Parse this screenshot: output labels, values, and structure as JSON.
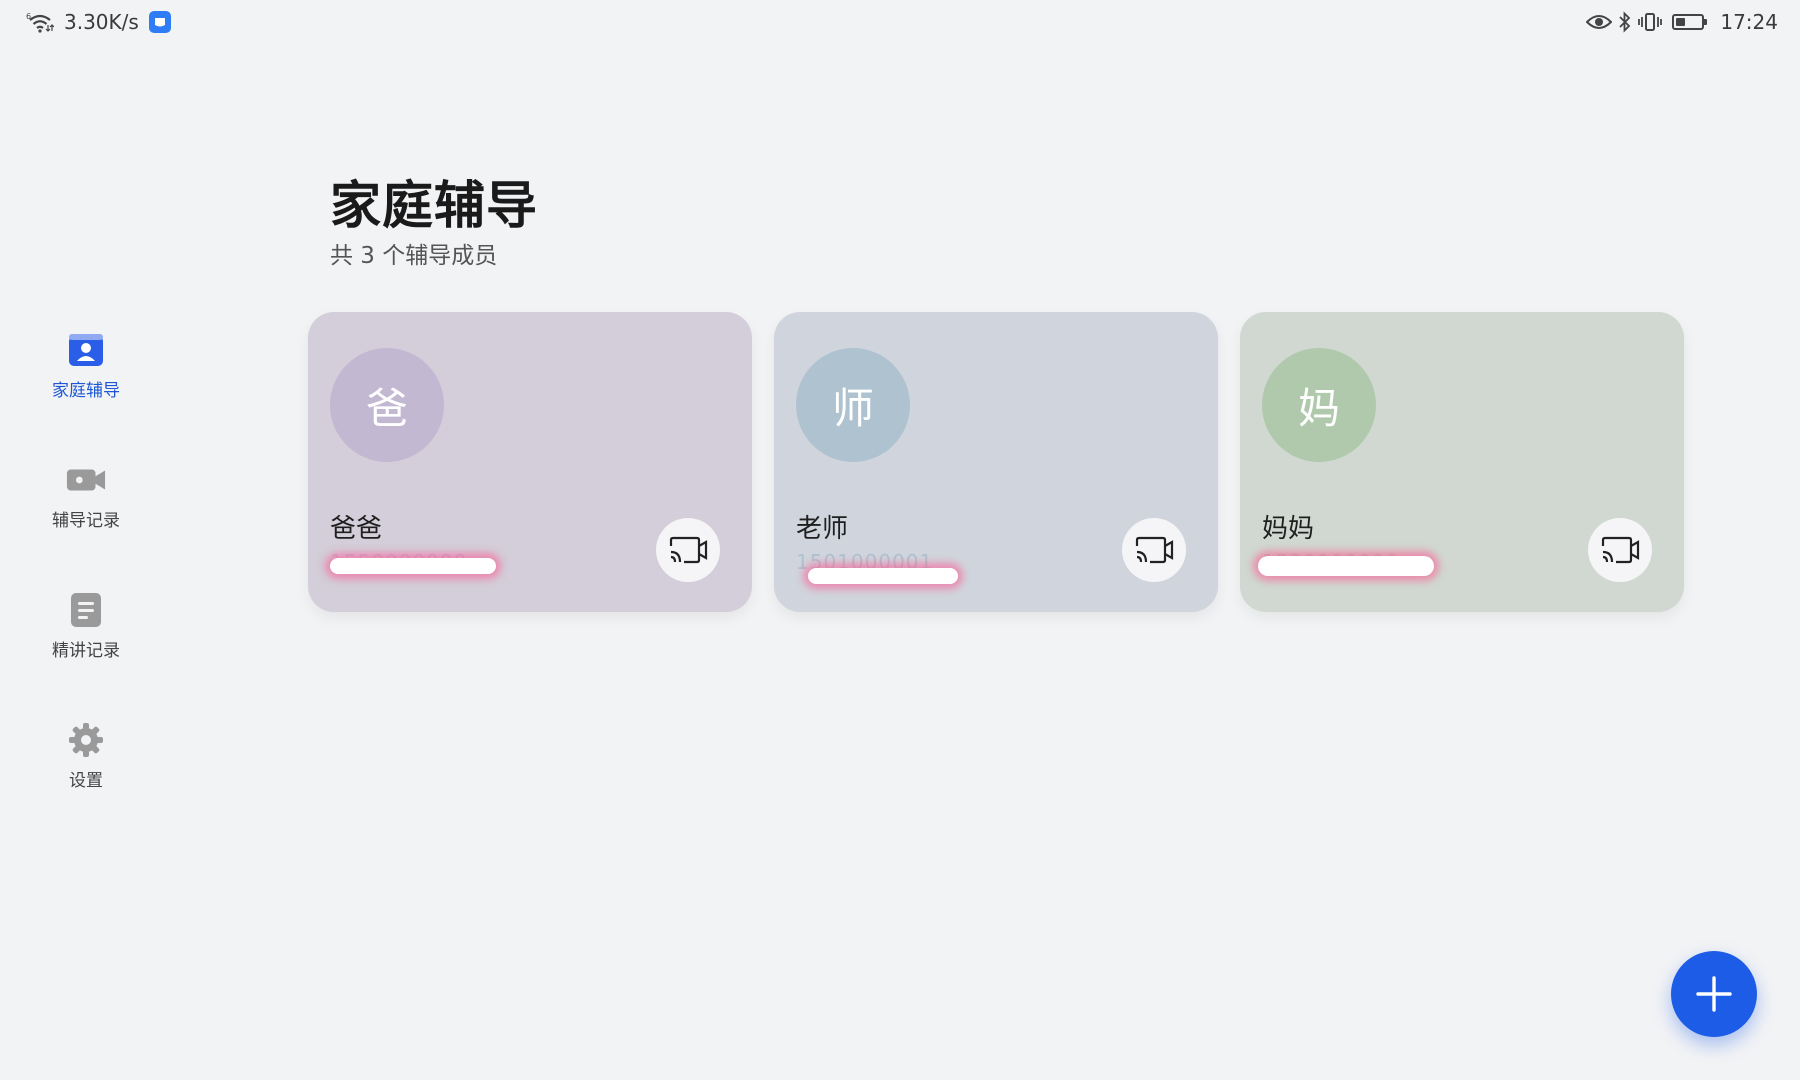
{
  "status_bar": {
    "network_speed": "3.30K/s",
    "time": "17:24",
    "icons": [
      "wifi-icon",
      "app-badge-icon",
      "eye-comfort-icon",
      "bluetooth-icon",
      "vibrate-icon",
      "battery-icon"
    ],
    "battery_level": 0.35
  },
  "sidebar": {
    "items": [
      {
        "label": "家庭辅导",
        "icon": "person-badge-icon",
        "active": true
      },
      {
        "label": "辅导记录",
        "icon": "video-camera-icon",
        "active": false
      },
      {
        "label": "精讲记录",
        "icon": "document-icon",
        "active": false
      },
      {
        "label": "设置",
        "icon": "gear-icon",
        "active": false
      }
    ]
  },
  "header": {
    "title": "家庭辅导",
    "subtitle": "共 3 个辅导成员"
  },
  "members": [
    {
      "avatar_char": "爸",
      "name": "爸爸",
      "phone": "1550000000",
      "card_color": "#d3ced9",
      "avatar_color": "#c3b8d1"
    },
    {
      "avatar_char": "师",
      "name": "老师",
      "phone": "1501000001",
      "card_color": "#d0d5dd",
      "avatar_color": "#aec2d0"
    },
    {
      "avatar_char": "妈",
      "name": "妈妈",
      "phone": "1530000000",
      "card_color": "#d0d8d1",
      "avatar_color": "#b0c9ac"
    }
  ],
  "colors": {
    "accent": "#1d5ce6",
    "active_nav": "#1d57d6",
    "background": "#f2f3f5"
  },
  "fab": {
    "icon": "plus-icon"
  }
}
